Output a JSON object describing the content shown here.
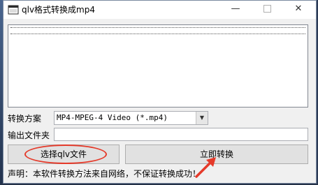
{
  "window": {
    "title": "qlv格式转换成mp4",
    "minimize_glyph": "—",
    "close_glyph": "✕"
  },
  "form": {
    "scheme_label": "转换方案",
    "scheme_value": "MP4-MPEG-4 Video (*.mp4)",
    "output_label": "输出文件夹",
    "output_value": ""
  },
  "buttons": {
    "choose_label": "选择qlv文件",
    "convert_label": "立即转换"
  },
  "status": {
    "text": "声明：本软件转换方法来自网络，不保证转换成功！"
  },
  "icons": {
    "app": "app-window-icon",
    "dropdown": "chevron-down-icon",
    "annotation_arrow": "red-arrow-icon"
  },
  "colors": {
    "annotation": "#e53a2a",
    "button_face": "#e1e1e1",
    "window_bg": "#f0f0f0"
  }
}
